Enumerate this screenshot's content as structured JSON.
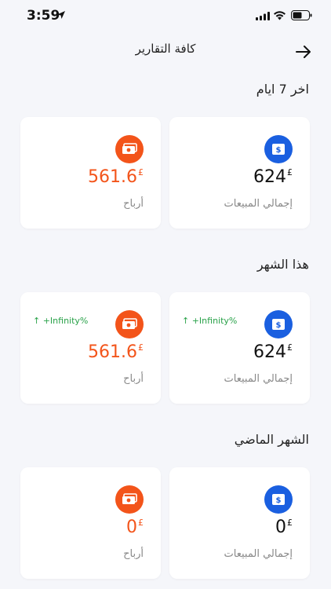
{
  "status_bar": {
    "time": "3:59"
  },
  "header": {
    "title": "كافة التقارير"
  },
  "sections": [
    {
      "title": "اخر 7 ايام",
      "cards": [
        {
          "value": "624",
          "currency": "£",
          "label": "إجمالي المبيعات",
          "growth": ""
        },
        {
          "value": "561.6",
          "currency": "£",
          "label": "أرباح",
          "growth": ""
        }
      ]
    },
    {
      "title": "هذا الشهر",
      "cards": [
        {
          "value": "624",
          "currency": "£",
          "label": "إجمالي المبيعات",
          "growth": "+Infinity%"
        },
        {
          "value": "561.6",
          "currency": "£",
          "label": "أرباح",
          "growth": "+Infinity%"
        }
      ]
    },
    {
      "title": "الشهر الماضي",
      "cards": [
        {
          "value": "0",
          "currency": "£",
          "label": "إجمالي المبيعات",
          "growth": ""
        },
        {
          "value": "0",
          "currency": "£",
          "label": "أرباح",
          "growth": ""
        }
      ]
    }
  ],
  "colors": {
    "sales_accent": "#1a5fe0",
    "profit_accent": "#f3541a",
    "growth": "#2aa24a"
  },
  "icons": {
    "sales": "dollar-icon",
    "profit": "cash-icon"
  }
}
